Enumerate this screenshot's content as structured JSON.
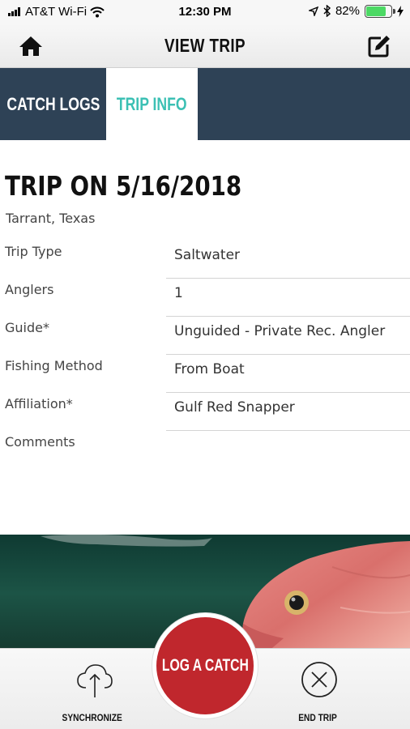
{
  "status_bar": {
    "carrier": "AT&T Wi-Fi",
    "time": "12:30 PM",
    "battery_percent": "82%",
    "battery_level": 0.82,
    "icons": [
      "signal-icon",
      "wifi-icon",
      "location-icon",
      "bluetooth-icon",
      "battery-icon",
      "charging-icon"
    ]
  },
  "header": {
    "title": "VIEW TRIP",
    "left_icon": "home-icon",
    "right_icon": "edit-icon"
  },
  "tabs": [
    {
      "label": "CATCH LOGS",
      "active": false
    },
    {
      "label": "TRIP INFO",
      "active": true
    }
  ],
  "trip": {
    "title": "TRIP ON 5/16/2018",
    "location": "Tarrant, Texas",
    "details": [
      {
        "label": "Trip Type",
        "value": "Saltwater"
      },
      {
        "label": "Anglers",
        "value": "1"
      },
      {
        "label": "Guide*",
        "value": "Unguided - Private Rec. Angler"
      },
      {
        "label": "Fishing Method",
        "value": "From Boat"
      },
      {
        "label": "Affiliation*",
        "value": "Gulf Red Snapper"
      },
      {
        "label": "Comments",
        "value": ""
      }
    ]
  },
  "bottom_bar": {
    "sync_label": "SYNCHRONIZE",
    "log_catch_label": "LOG A CATCH",
    "end_trip_label": "END TRIP"
  },
  "colors": {
    "tab_bar": "#2e4256",
    "active_tab_text": "#3cc0b4",
    "log_catch": "#c0272d"
  }
}
